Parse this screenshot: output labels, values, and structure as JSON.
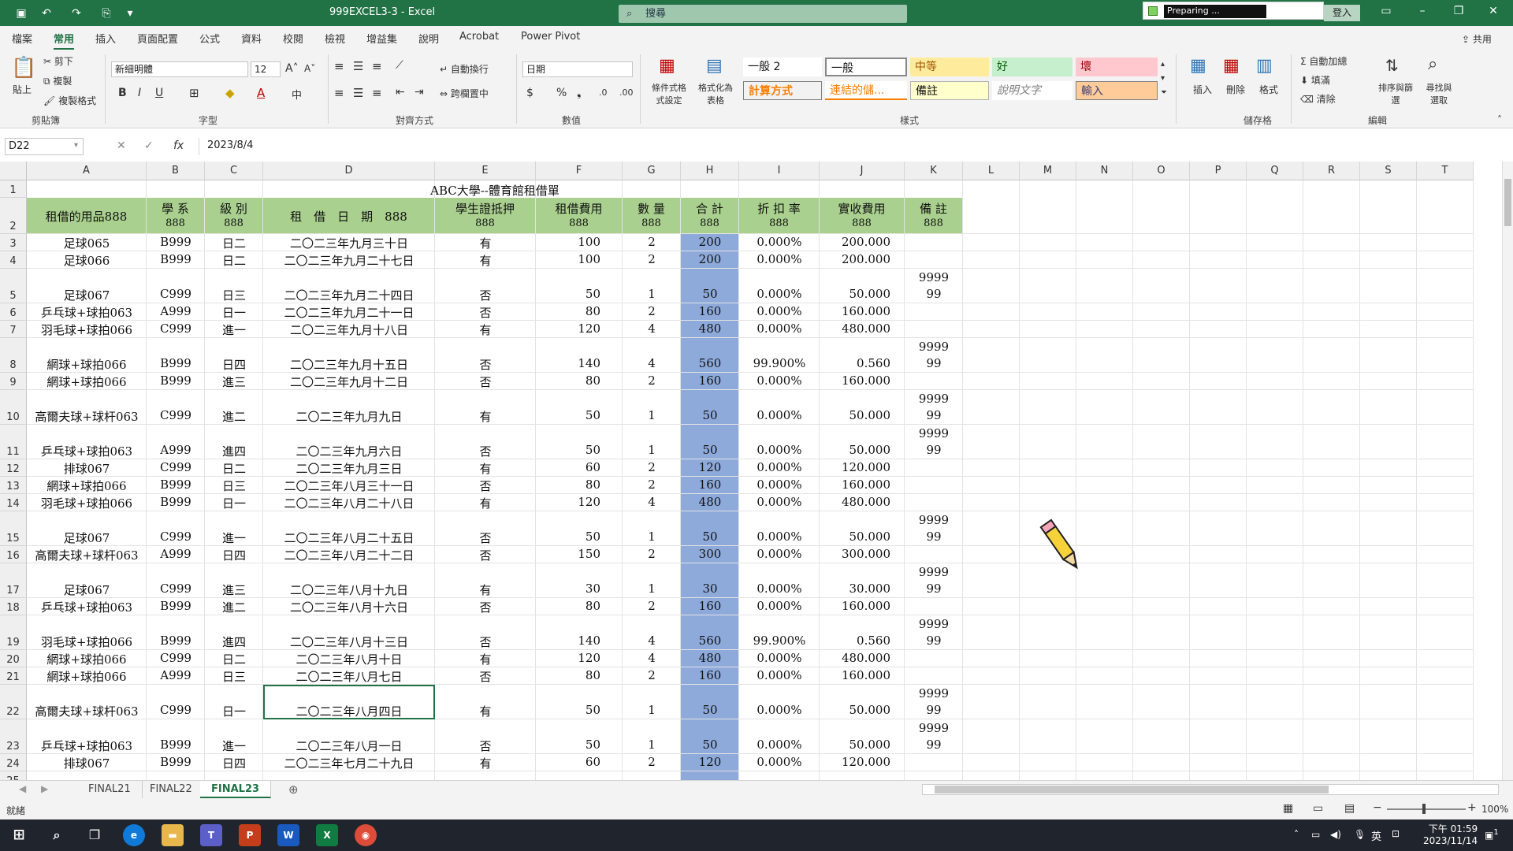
{
  "window": {
    "title": "999EXCEL3-3  -  Excel",
    "search_placeholder": "搜尋",
    "status_popup": "Preparing ...",
    "login_label": "登入",
    "share_label": "共用"
  },
  "ribbon_tabs": [
    "檔案",
    "常用",
    "插入",
    "頁面配置",
    "公式",
    "資料",
    "校閱",
    "檢視",
    "增益集",
    "說明",
    "Acrobat",
    "Power Pivot"
  ],
  "ribbon": {
    "clipboard": {
      "paste": "貼上",
      "cut": "剪下",
      "copy": "複製",
      "format_painter": "複製格式",
      "label": "剪貼簿"
    },
    "font": {
      "name": "新細明體",
      "size": "12",
      "label": "字型"
    },
    "alignment": {
      "wrap": "自動換行",
      "merge": "跨欄置中",
      "label": "對齊方式"
    },
    "number": {
      "format": "日期",
      "label": "數值"
    },
    "styles": {
      "conditional": "條件式格式設定",
      "as_table": "格式化為表格",
      "label": "樣式",
      "cells": [
        {
          "text": "一般 2",
          "bg": "#ffffff",
          "color": "#111111"
        },
        {
          "text": "一般",
          "bg": "#ffffff",
          "color": "#111111"
        },
        {
          "text": "中等",
          "bg": "#ffeb9c",
          "color": "#9c5700"
        },
        {
          "text": "好",
          "bg": "#c6efce",
          "color": "#006100"
        },
        {
          "text": "壞",
          "bg": "#ffc7ce",
          "color": "#9c0006"
        },
        {
          "text": "計算方式",
          "bg": "#f2f2f2",
          "color": "#fa7d00"
        },
        {
          "text": "連結的儲...",
          "bg": "#ffffff",
          "color": "#fa7d00"
        },
        {
          "text": "備註",
          "bg": "#ffffcc",
          "color": "#111111"
        },
        {
          "text": "說明文字",
          "bg": "#ffffff",
          "color": "#7f7f7f"
        },
        {
          "text": "輸入",
          "bg": "#ffcc99",
          "color": "#3f3f76"
        }
      ]
    },
    "cells_group": {
      "insert": "插入",
      "delete": "刪除",
      "format": "格式",
      "label": "儲存格"
    },
    "editing": {
      "autosum": "自動加總",
      "fill": "填滿",
      "clear": "清除",
      "sort": "排序與篩選",
      "find": "尋找與選取",
      "label": "編輯"
    }
  },
  "formula_bar": {
    "name_box": "D22",
    "fx": "fx",
    "value": "2023/8/4"
  },
  "columns": [
    "A",
    "B",
    "C",
    "D",
    "E",
    "F",
    "G",
    "H",
    "I",
    "J",
    "K",
    "L",
    "M",
    "N",
    "O",
    "P",
    "Q",
    "R",
    "S",
    "T"
  ],
  "sheet": {
    "title": "ABC大學--體育館租借單",
    "headers": [
      {
        "l1": "租借的用品888",
        "l2": ""
      },
      {
        "l1": "學 系",
        "l2": "888"
      },
      {
        "l1": "級 別",
        "l2": "888"
      },
      {
        "l1": "租　借　日　期　888",
        "l2": ""
      },
      {
        "l1": "學生證抵押",
        "l2": "888"
      },
      {
        "l1": "租借費用",
        "l2": "888"
      },
      {
        "l1": "數 量",
        "l2": "888"
      },
      {
        "l1": "合 計",
        "l2": "888"
      },
      {
        "l1": "折 扣 率",
        "l2": "888"
      },
      {
        "l1": "實收費用",
        "l2": "888"
      },
      {
        "l1": "備 註",
        "l2": "888"
      }
    ],
    "rows": [
      {
        "num": "3",
        "a": "足球065",
        "b": "B999",
        "c": "日二",
        "d": "二〇二三年九月三十日",
        "e": "有",
        "f": "100",
        "g": "2",
        "h": "200",
        "i": "0.000%",
        "j": "200.000",
        "k1": "",
        "k2": ""
      },
      {
        "num": "4",
        "a": "足球066",
        "b": "B999",
        "c": "日二",
        "d": "二〇二三年九月二十七日",
        "e": "有",
        "f": "100",
        "g": "2",
        "h": "200",
        "i": "0.000%",
        "j": "200.000",
        "k1": "",
        "k2": ""
      },
      {
        "num": "5",
        "a": "足球067",
        "b": "C999",
        "c": "日三",
        "d": "二〇二三年九月二十四日",
        "e": "否",
        "f": "50",
        "g": "1",
        "h": "50",
        "i": "0.000%",
        "j": "50.000",
        "k1": "9999",
        "k2": "99"
      },
      {
        "num": "6",
        "a": "乒乓球+球拍063",
        "b": "A999",
        "c": "日一",
        "d": "二〇二三年九月二十一日",
        "e": "否",
        "f": "80",
        "g": "2",
        "h": "160",
        "i": "0.000%",
        "j": "160.000",
        "k1": "",
        "k2": ""
      },
      {
        "num": "7",
        "a": "羽毛球+球拍066",
        "b": "C999",
        "c": "進一",
        "d": "二〇二三年九月十八日",
        "e": "有",
        "f": "120",
        "g": "4",
        "h": "480",
        "i": "0.000%",
        "j": "480.000",
        "k1": "",
        "k2": ""
      },
      {
        "num": "8",
        "a": "網球+球拍066",
        "b": "B999",
        "c": "日四",
        "d": "二〇二三年九月十五日",
        "e": "否",
        "f": "140",
        "g": "4",
        "h": "560",
        "i": "99.900%",
        "j": "0.560",
        "k1": "9999",
        "k2": "99"
      },
      {
        "num": "9",
        "a": "網球+球拍066",
        "b": "B999",
        "c": "進三",
        "d": "二〇二三年九月十二日",
        "e": "否",
        "f": "80",
        "g": "2",
        "h": "160",
        "i": "0.000%",
        "j": "160.000",
        "k1": "",
        "k2": ""
      },
      {
        "num": "10",
        "a": "高爾夫球+球杆063",
        "b": "C999",
        "c": "進二",
        "d": "二〇二三年九月九日",
        "e": "有",
        "f": "50",
        "g": "1",
        "h": "50",
        "i": "0.000%",
        "j": "50.000",
        "k1": "9999",
        "k2": "99"
      },
      {
        "num": "11",
        "a": "乒乓球+球拍063",
        "b": "A999",
        "c": "進四",
        "d": "二〇二三年九月六日",
        "e": "否",
        "f": "50",
        "g": "1",
        "h": "50",
        "i": "0.000%",
        "j": "50.000",
        "k1": "9999",
        "k2": "99"
      },
      {
        "num": "12",
        "a": "排球067",
        "b": "C999",
        "c": "日二",
        "d": "二〇二三年九月三日",
        "e": "有",
        "f": "60",
        "g": "2",
        "h": "120",
        "i": "0.000%",
        "j": "120.000",
        "k1": "",
        "k2": ""
      },
      {
        "num": "13",
        "a": "網球+球拍066",
        "b": "B999",
        "c": "日三",
        "d": "二〇二三年八月三十一日",
        "e": "否",
        "f": "80",
        "g": "2",
        "h": "160",
        "i": "0.000%",
        "j": "160.000",
        "k1": "",
        "k2": ""
      },
      {
        "num": "14",
        "a": "羽毛球+球拍066",
        "b": "B999",
        "c": "日一",
        "d": "二〇二三年八月二十八日",
        "e": "有",
        "f": "120",
        "g": "4",
        "h": "480",
        "i": "0.000%",
        "j": "480.000",
        "k1": "",
        "k2": ""
      },
      {
        "num": "15",
        "a": "足球067",
        "b": "C999",
        "c": "進一",
        "d": "二〇二三年八月二十五日",
        "e": "否",
        "f": "50",
        "g": "1",
        "h": "50",
        "i": "0.000%",
        "j": "50.000",
        "k1": "9999",
        "k2": "99"
      },
      {
        "num": "16",
        "a": "高爾夫球+球杆063",
        "b": "A999",
        "c": "日四",
        "d": "二〇二三年八月二十二日",
        "e": "否",
        "f": "150",
        "g": "2",
        "h": "300",
        "i": "0.000%",
        "j": "300.000",
        "k1": "",
        "k2": ""
      },
      {
        "num": "17",
        "a": "足球067",
        "b": "C999",
        "c": "進三",
        "d": "二〇二三年八月十九日",
        "e": "有",
        "f": "30",
        "g": "1",
        "h": "30",
        "i": "0.000%",
        "j": "30.000",
        "k1": "9999",
        "k2": "99"
      },
      {
        "num": "18",
        "a": "乒乓球+球拍063",
        "b": "B999",
        "c": "進二",
        "d": "二〇二三年八月十六日",
        "e": "否",
        "f": "80",
        "g": "2",
        "h": "160",
        "i": "0.000%",
        "j": "160.000",
        "k1": "",
        "k2": ""
      },
      {
        "num": "19",
        "a": "羽毛球+球拍066",
        "b": "B999",
        "c": "進四",
        "d": "二〇二三年八月十三日",
        "e": "否",
        "f": "140",
        "g": "4",
        "h": "560",
        "i": "99.900%",
        "j": "0.560",
        "k1": "9999",
        "k2": "99"
      },
      {
        "num": "20",
        "a": "網球+球拍066",
        "b": "C999",
        "c": "日二",
        "d": "二〇二三年八月十日",
        "e": "有",
        "f": "120",
        "g": "4",
        "h": "480",
        "i": "0.000%",
        "j": "480.000",
        "k1": "",
        "k2": ""
      },
      {
        "num": "21",
        "a": "網球+球拍066",
        "b": "A999",
        "c": "日三",
        "d": "二〇二三年八月七日",
        "e": "否",
        "f": "80",
        "g": "2",
        "h": "160",
        "i": "0.000%",
        "j": "160.000",
        "k1": "",
        "k2": ""
      },
      {
        "num": "22",
        "a": "高爾夫球+球杆063",
        "b": "C999",
        "c": "日一",
        "d": "二〇二三年八月四日",
        "e": "有",
        "f": "50",
        "g": "1",
        "h": "50",
        "i": "0.000%",
        "j": "50.000",
        "k1": "9999",
        "k2": "99"
      },
      {
        "num": "23",
        "a": "乒乓球+球拍063",
        "b": "B999",
        "c": "進一",
        "d": "二〇二三年八月一日",
        "e": "否",
        "f": "50",
        "g": "1",
        "h": "50",
        "i": "0.000%",
        "j": "50.000",
        "k1": "9999",
        "k2": "99"
      },
      {
        "num": "24",
        "a": "排球067",
        "b": "B999",
        "c": "日四",
        "d": "二〇二三年七月二十九日",
        "e": "有",
        "f": "60",
        "g": "2",
        "h": "120",
        "i": "0.000%",
        "j": "120.000",
        "k1": "",
        "k2": ""
      }
    ]
  },
  "sheet_tabs": [
    "FINAL21",
    "FINAL22",
    "FINAL23"
  ],
  "active_sheet": "FINAL23",
  "status": {
    "ready": "就緒",
    "zoom": "100%"
  },
  "taskbar": {
    "time": "下午 01:59",
    "date": "2023/11/14",
    "ime": "英",
    "notif": "1"
  },
  "colors": {
    "excel_green": "#217346",
    "header_green": "#a9d08e",
    "total_blue": "#8eaadb"
  }
}
